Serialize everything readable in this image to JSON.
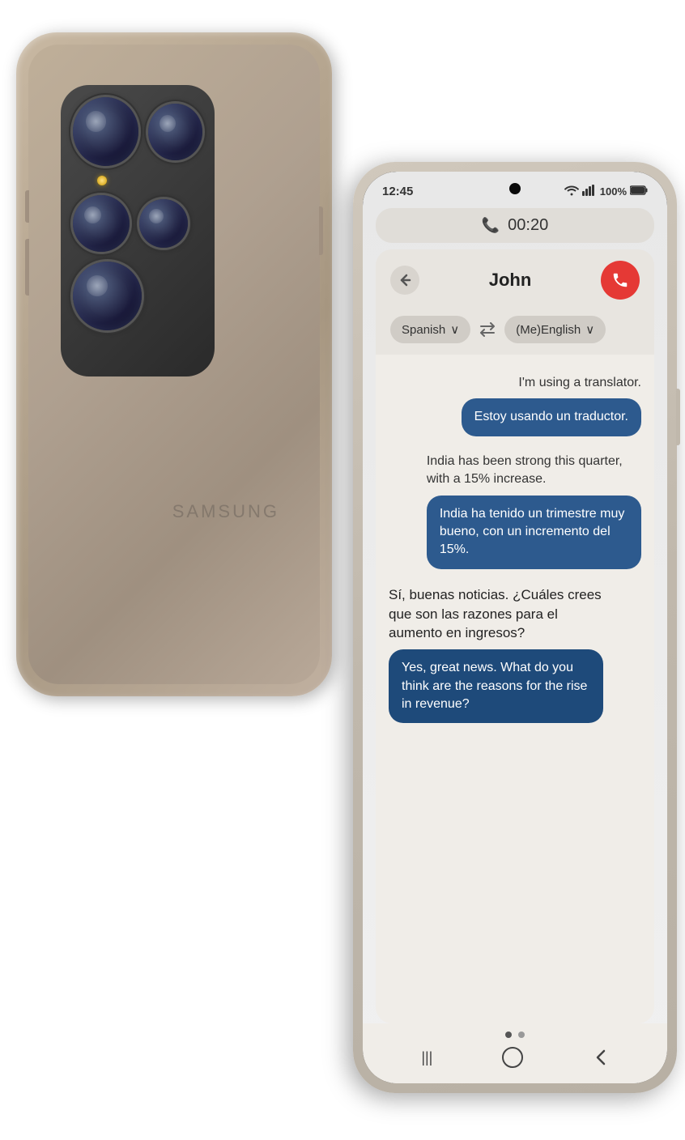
{
  "back_phone": {
    "brand": "SAMSUNG"
  },
  "front_phone": {
    "status_bar": {
      "time": "12:45",
      "battery": "100%",
      "signal": "📶"
    },
    "call": {
      "duration": "00:20"
    },
    "translator": {
      "contact_name": "John",
      "language_from": "Spanish",
      "language_from_arrow": "∨",
      "swap_icon": "⇄",
      "language_to": "(Me)English",
      "language_to_arrow": "∨"
    },
    "messages": [
      {
        "id": 1,
        "text_light": "I'm using a translator.",
        "text_dark": "Estoy usando un traductor.",
        "side": "right"
      },
      {
        "id": 2,
        "text_light": "India has been strong this quarter, with a 15% increase.",
        "text_dark": "India ha tenido un trimestre muy bueno, con un incremento del 15%.",
        "side": "right"
      },
      {
        "id": 3,
        "text_spanish": "Sí, buenas noticias. ¿Cuáles crees que son las razones para el aumento en ingresos?",
        "text_english": "Yes, great news. What do you think are the reasons for the rise in revenue?",
        "side": "left"
      }
    ],
    "nav": {
      "dots": [
        "active",
        "inactive"
      ],
      "back_icon": "|||",
      "home_icon": "○",
      "recent_icon": "<"
    }
  }
}
